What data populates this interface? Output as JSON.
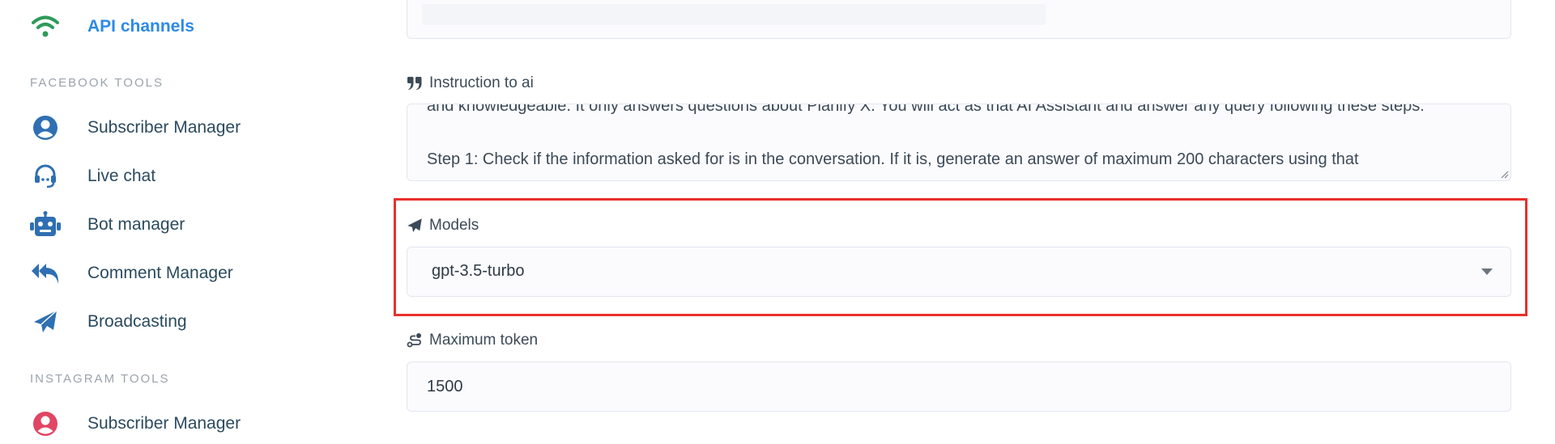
{
  "sidebar": {
    "active_item": {
      "label": "API channels",
      "icon": "wifi-icon"
    },
    "sections": [
      {
        "heading": "FACEBOOK TOOLS",
        "items": [
          {
            "label": "Subscriber Manager",
            "icon": "user-circle-icon"
          },
          {
            "label": "Live chat",
            "icon": "headset-icon"
          },
          {
            "label": "Bot manager",
            "icon": "robot-icon"
          },
          {
            "label": "Comment Manager",
            "icon": "reply-all-icon"
          },
          {
            "label": "Broadcasting",
            "icon": "paper-plane-icon"
          }
        ]
      },
      {
        "heading": "INSTAGRAM TOOLS",
        "items": [
          {
            "label": "Subscriber Manager",
            "icon": "user-circle-icon"
          }
        ]
      }
    ]
  },
  "form": {
    "instruction": {
      "label": "Instruction to ai",
      "icon": "quote-icon",
      "text": "and knowledgeable. It only answers questions about Planify X. You will act as that AI Assistant and answer any query following these steps:\n\nStep 1: Check if the information asked for is in the conversation. If it is, generate an answer of maximum 200 characters using that"
    },
    "models": {
      "label": "Models",
      "icon": "paper-plane-icon",
      "selected": "gpt-3.5-turbo"
    },
    "max_token": {
      "label": "Maximum token",
      "icon": "route-icon",
      "value": "1500"
    }
  },
  "colors": {
    "accent": "#2d8ae6",
    "nav_text": "#2b4a5e",
    "wifi_icon": "#2e9a5a",
    "nav_icon": "#2f6fb3",
    "instagram_icon": "#e04664",
    "highlight": "#e8302c"
  }
}
